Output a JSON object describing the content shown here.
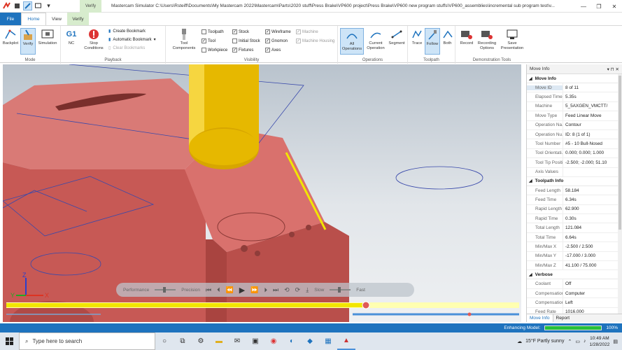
{
  "titlebar": {
    "verify_context_label": "Verify",
    "window_title": "Mastercam Simulator  C:\\Users\\Rsteiff\\Documents\\My Mastercam 2022\\Mastercam\\Parts\\2020 stuff\\Press Brake\\VP600 project\\Press Brake\\VP600 new program stuffs\\VP600_assemblies\\incremental sub program test\\v...",
    "controls": [
      "—",
      "❐",
      "✕"
    ]
  },
  "tabs": {
    "file": "File",
    "home": "Home",
    "view": "View",
    "verify": "Verify"
  },
  "ribbon": {
    "mode": {
      "label": "Mode",
      "backplot": "Backplot",
      "verify": "Verify",
      "simulation": "Simulation"
    },
    "playback": {
      "label": "Playback",
      "nc_icon": "G1",
      "nc": "NC",
      "stop_conditions": "Stop Conditions",
      "create_bookmark": "Create Bookmark",
      "automatic_bookmark": "Automatic Bookmark",
      "clear_bookmarks": "Clear Bookmarks"
    },
    "visibility": {
      "label": "Visibility",
      "tool_components": "Tool Components",
      "toolpath": "Toolpath",
      "tool": "Tool",
      "workpiece": "Workpiece",
      "stock": "Stock",
      "initial_stock": "Initial Stock",
      "fixtures": "Fixtures",
      "wireframe": "Wireframe",
      "gnomon": "Gnomon",
      "axes": "Axes",
      "machine": "Machine",
      "machine_housing": "Machine Housing"
    },
    "operations": {
      "label": "Operations",
      "all": "All Operations",
      "current": "Current Operation",
      "segment": "Segment"
    },
    "toolpath": {
      "label": "Toolpath",
      "trace": "Trace",
      "follow": "Follow",
      "both": "Both"
    },
    "demo": {
      "label": "Demonstration Tools",
      "record": "Record",
      "recording_options": "Recording Options",
      "save_presentation": "Save Presentation"
    }
  },
  "sim_controls": {
    "performance": "Performance",
    "precision": "Precision",
    "slow": "Slow",
    "fast": "Fast"
  },
  "axes_labels": {
    "x": "X",
    "y": "Y",
    "z": "Z"
  },
  "panel": {
    "title": "Move Info",
    "move_info_header": "Move Info",
    "move_info": [
      {
        "k": "Move ID",
        "v": "8 of 11"
      },
      {
        "k": "Elapsed Time",
        "v": "5.35s"
      },
      {
        "k": "Machine",
        "v": "5_5AXGEN_VMCTT/"
      },
      {
        "k": "Move Type",
        "v": "Feed Linear Move"
      },
      {
        "k": "Operation Na...",
        "v": "Contour"
      },
      {
        "k": "Operation Nu...",
        "v": "ID: 8 (1 of 1)"
      },
      {
        "k": "Tool Number",
        "v": "#5 - 10 Bull-Nosed"
      },
      {
        "k": "Tool Orientati...",
        "v": "0.000; 0.000; 1.000"
      },
      {
        "k": "Tool Tip Positi...",
        "v": "-2.500; -2.000; 51.10"
      },
      {
        "k": "Axis Values",
        "v": ""
      }
    ],
    "toolpath_info_header": "Toolpath Info",
    "toolpath_info": [
      {
        "k": "Feed Length",
        "v": "58.184"
      },
      {
        "k": "Feed Time",
        "v": "6.34s"
      },
      {
        "k": "Rapid Length",
        "v": "62.900"
      },
      {
        "k": "Rapid Time",
        "v": "0.30s"
      },
      {
        "k": "Total Length",
        "v": "121.084"
      },
      {
        "k": "Total Time",
        "v": "6.64s"
      },
      {
        "k": "Min/Max X",
        "v": "-2.500 / 2.500"
      },
      {
        "k": "Min/Max Y",
        "v": "-17.000 / 3.000"
      },
      {
        "k": "Min/Max Z",
        "v": "41.100 / 75.000"
      }
    ],
    "verbose_header": "Verbose",
    "verbose": [
      {
        "k": "Coolant",
        "v": "Off"
      },
      {
        "k": "Compensation...",
        "v": "Computer"
      },
      {
        "k": "Compensation...",
        "v": "Left"
      },
      {
        "k": "Feed Rate",
        "v": "1016.000"
      }
    ],
    "tab_move_info": "Move Info",
    "tab_report": "Report"
  },
  "status": {
    "text": "Enhancing Model:",
    "percent": "100%",
    "progress": 1.0
  },
  "taskbar": {
    "search_placeholder": "Type here to search",
    "weather": "15°F  Partly sunny",
    "time": "10:49 AM",
    "date": "1/28/2022"
  },
  "colors": {
    "accent": "#1e73be",
    "stock": "#d9625f",
    "tool": "#e0b400",
    "toolpath": "#f0e000",
    "progress": "#26c03a"
  }
}
